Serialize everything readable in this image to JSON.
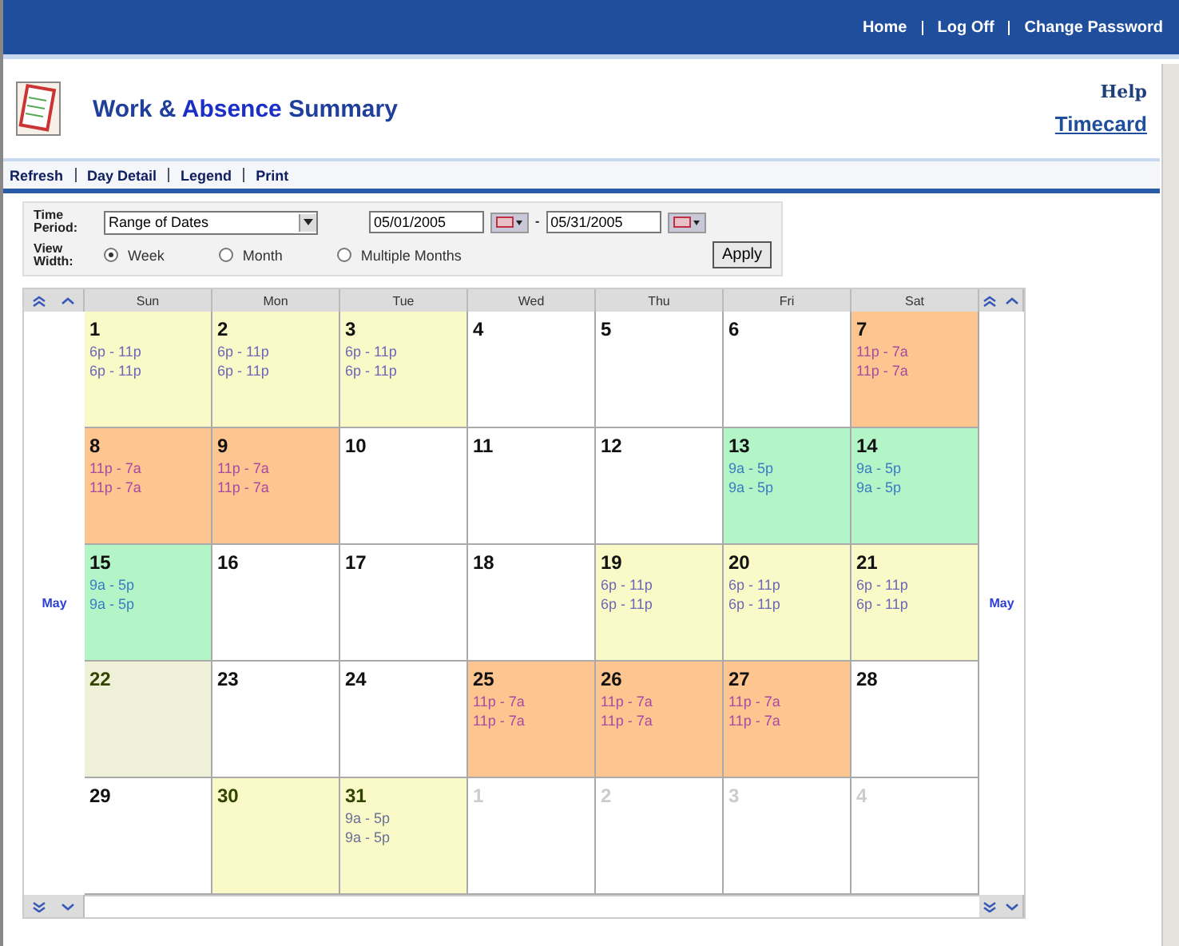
{
  "top_links": [
    "Home",
    "Log Off",
    "Change Password"
  ],
  "title": {
    "part_1": "Work &",
    "part_2": "Absence",
    "part_3": "Summary"
  },
  "help": "Help",
  "timecard": "Timecard",
  "toolbar": [
    "Refresh",
    "Day Detail",
    "Legend",
    "Print"
  ],
  "form": {
    "time_period_label": "Time Period:",
    "time_period": "Range of Dates",
    "start_date": "05/01/2005",
    "date_separator": "-",
    "end_date": "05/31/2005",
    "view_width_label": "View Width:",
    "view_options": [
      {
        "label": "Week",
        "selected": true
      },
      {
        "label": "Month",
        "selected": false
      },
      {
        "label": "Multiple Months",
        "selected": false
      }
    ],
    "apply": "Apply"
  },
  "calendar": {
    "weekdays": [
      "Sun",
      "Mon",
      "Tue",
      "Wed",
      "Thu",
      "Fri",
      "Sat"
    ],
    "month_left": "May",
    "month_right": "May",
    "weeks": [
      [
        {
          "day": "1",
          "kind": "evening",
          "shifts": [
            "6p - 11p",
            "6p - 11p"
          ]
        },
        {
          "day": "2",
          "kind": "evening",
          "shifts": [
            "6p - 11p",
            "6p - 11p"
          ]
        },
        {
          "day": "3",
          "kind": "evening",
          "shifts": [
            "6p - 11p",
            "6p - 11p"
          ]
        },
        {
          "day": "4",
          "kind": "none"
        },
        {
          "day": "5",
          "kind": "none"
        },
        {
          "day": "6",
          "kind": "none"
        },
        {
          "day": "7",
          "kind": "night",
          "shifts": [
            "11p - 7a",
            "11p - 7a"
          ]
        }
      ],
      [
        {
          "day": "8",
          "kind": "night",
          "shifts": [
            "11p - 7a",
            "11p - 7a"
          ]
        },
        {
          "day": "9",
          "kind": "night",
          "shifts": [
            "11p - 7a",
            "11p - 7a"
          ]
        },
        {
          "day": "10",
          "kind": "none"
        },
        {
          "day": "11",
          "kind": "none"
        },
        {
          "day": "12",
          "kind": "none"
        },
        {
          "day": "13",
          "kind": "day",
          "shifts": [
            "9a - 5p",
            "9a - 5p"
          ]
        },
        {
          "day": "14",
          "kind": "day",
          "shifts": [
            "9a - 5p",
            "9a - 5p"
          ]
        }
      ],
      [
        {
          "day": "15",
          "kind": "day",
          "shifts": [
            "9a - 5p",
            "9a - 5p"
          ]
        },
        {
          "day": "16",
          "kind": "none"
        },
        {
          "day": "17",
          "kind": "none"
        },
        {
          "day": "18",
          "kind": "none"
        },
        {
          "day": "19",
          "kind": "evening",
          "shifts": [
            "6p - 11p",
            "6p - 11p"
          ]
        },
        {
          "day": "20",
          "kind": "evening",
          "shifts": [
            "6p - 11p",
            "6p - 11p"
          ]
        },
        {
          "day": "21",
          "kind": "evening",
          "shifts": [
            "6p - 11p",
            "6p - 11p"
          ]
        }
      ],
      [
        {
          "day": "22",
          "kind": "holiday"
        },
        {
          "day": "23",
          "kind": "none"
        },
        {
          "day": "24",
          "kind": "none"
        },
        {
          "day": "25",
          "kind": "night",
          "shifts": [
            "11p - 7a",
            "11p - 7a"
          ]
        },
        {
          "day": "26",
          "kind": "night",
          "shifts": [
            "11p - 7a",
            "11p - 7a"
          ]
        },
        {
          "day": "27",
          "kind": "night",
          "shifts": [
            "11p - 7a",
            "11p - 7a"
          ]
        },
        {
          "day": "28",
          "kind": "none"
        }
      ],
      [
        {
          "day": "29",
          "kind": "none"
        },
        {
          "day": "30",
          "kind": "scheduled"
        },
        {
          "day": "31",
          "kind": "scheduled",
          "shifts": [
            "9a - 5p",
            "9a - 5p"
          ]
        },
        {
          "day": "1",
          "kind": "outside"
        },
        {
          "day": "2",
          "kind": "outside"
        },
        {
          "day": "3",
          "kind": "outside"
        },
        {
          "day": "4",
          "kind": "outside"
        }
      ]
    ]
  }
}
